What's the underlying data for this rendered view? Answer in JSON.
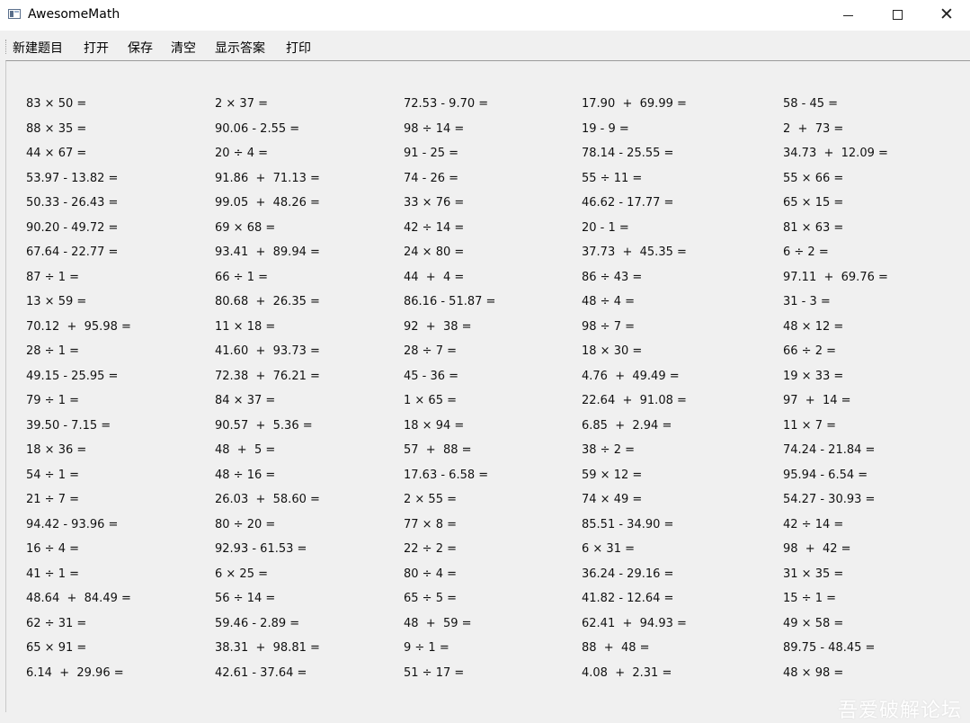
{
  "window": {
    "title": "AwesomeMath",
    "controls": {
      "minimize": "–",
      "maximize": "□",
      "close": "✕"
    }
  },
  "menu": {
    "items": [
      "新建题目",
      "打开",
      "保存",
      "清空",
      "显示答案",
      "打印"
    ]
  },
  "problems": {
    "columns": [
      [
        "83 × 50 =",
        "88 × 35 =",
        "44 × 67 =",
        "53.97 - 13.82 =",
        "50.33 - 26.43 =",
        "90.20 - 49.72 =",
        "67.64 - 22.77 =",
        "87 ÷ 1 =",
        "13 × 59 =",
        "70.12  +  95.98 =",
        "28 ÷ 1 =",
        "49.15 - 25.95 =",
        "79 ÷ 1 =",
        "39.50 - 7.15 =",
        "18 × 36 =",
        "54 ÷ 1 =",
        "21 ÷ 7 =",
        "94.42 - 93.96 =",
        "16 ÷ 4 =",
        "41 ÷ 1 =",
        "48.64  +  84.49 =",
        "62 ÷ 31 =",
        "65 × 91 =",
        "6.14  +  29.96 ="
      ],
      [
        "2 × 37 =",
        "90.06 - 2.55 =",
        "20 ÷ 4 =",
        "91.86  +  71.13 =",
        "99.05  +  48.26 =",
        "69 × 68 =",
        "93.41  +  89.94 =",
        "66 ÷ 1 =",
        "80.68  +  26.35 =",
        "11 × 18 =",
        "41.60  +  93.73 =",
        "72.38  +  76.21 =",
        "84 × 37 =",
        "90.57  +  5.36 =",
        "48  +  5 =",
        "48 ÷ 16 =",
        "26.03  +  58.60 =",
        "80 ÷ 20 =",
        "92.93 - 61.53 =",
        "6 × 25 =",
        "56 ÷ 14 =",
        "59.46 - 2.89 =",
        "38.31  +  98.81 =",
        "42.61 - 37.64 ="
      ],
      [
        "72.53 - 9.70 =",
        "98 ÷ 14 =",
        "91 - 25 =",
        "74 - 26 =",
        "33 × 76 =",
        "42 ÷ 14 =",
        "24 × 80 =",
        "44  +  4 =",
        "86.16 - 51.87 =",
        "92  +  38 =",
        "28 ÷ 7 =",
        "45 - 36 =",
        "1 × 65 =",
        "18 × 94 =",
        "57  +  88 =",
        "17.63 - 6.58 =",
        "2 × 55 =",
        "77 × 8 =",
        "22 ÷ 2 =",
        "80 ÷ 4 =",
        "65 ÷ 5 =",
        "48  +  59 =",
        "9 ÷ 1 =",
        "51 ÷ 17 ="
      ],
      [
        "17.90  +  69.99 =",
        "19 - 9 =",
        "78.14 - 25.55 =",
        "55 ÷ 11 =",
        "46.62 - 17.77 =",
        "20 - 1 =",
        "37.73  +  45.35 =",
        "86 ÷ 43 =",
        "48 ÷ 4 =",
        "98 ÷ 7 =",
        "18 × 30 =",
        "4.76  +  49.49 =",
        "22.64  +  91.08 =",
        "6.85  +  2.94 =",
        "38 ÷ 2 =",
        "59 × 12 =",
        "74 × 49 =",
        "85.51 - 34.90 =",
        "6 × 31 =",
        "36.24 - 29.16 =",
        "41.82 - 12.64 =",
        "62.41  +  94.93 =",
        "88  +  48 =",
        "4.08  +  2.31 ="
      ],
      [
        "58 - 45 =",
        "2  +  73 =",
        "34.73  +  12.09 =",
        "55 × 66 =",
        "65 × 15 =",
        "81 × 63 =",
        "6 ÷ 2 =",
        "97.11  +  69.76 =",
        "31 - 3 =",
        "48 × 12 =",
        "66 ÷ 2 =",
        "19 × 33 =",
        "97  +  14 =",
        "11 × 7 =",
        "74.24 - 21.84 =",
        "95.94 - 6.54 =",
        "54.27 - 30.93 =",
        "42 ÷ 14 =",
        "98  +  42 =",
        "31 × 35 =",
        "15 ÷ 1 =",
        "49 × 58 =",
        "89.75 - 48.45 =",
        "48 × 98 ="
      ]
    ]
  },
  "watermark": "吾爱破解论坛"
}
